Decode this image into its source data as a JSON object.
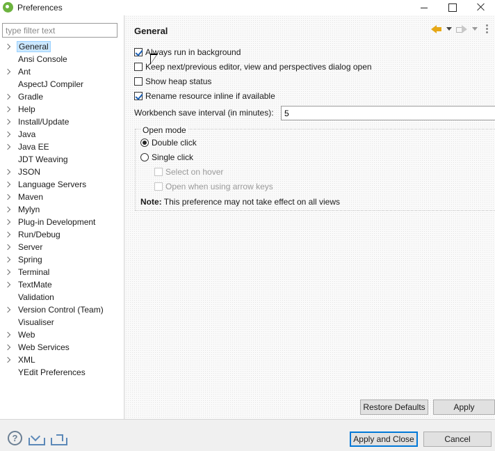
{
  "window": {
    "title": "Preferences"
  },
  "sidebar": {
    "filter_placeholder": "type filter text",
    "items": [
      {
        "label": "General",
        "expandable": true,
        "selected": true
      },
      {
        "label": "Ansi Console",
        "expandable": false
      },
      {
        "label": "Ant",
        "expandable": true
      },
      {
        "label": "AspectJ Compiler",
        "expandable": false
      },
      {
        "label": "Gradle",
        "expandable": true
      },
      {
        "label": "Help",
        "expandable": true
      },
      {
        "label": "Install/Update",
        "expandable": true
      },
      {
        "label": "Java",
        "expandable": true
      },
      {
        "label": "Java EE",
        "expandable": true
      },
      {
        "label": "JDT Weaving",
        "expandable": false
      },
      {
        "label": "JSON",
        "expandable": true
      },
      {
        "label": "Language Servers",
        "expandable": true
      },
      {
        "label": "Maven",
        "expandable": true
      },
      {
        "label": "Mylyn",
        "expandable": true
      },
      {
        "label": "Plug-in Development",
        "expandable": true
      },
      {
        "label": "Run/Debug",
        "expandable": true
      },
      {
        "label": "Server",
        "expandable": true
      },
      {
        "label": "Spring",
        "expandable": true
      },
      {
        "label": "Terminal",
        "expandable": true
      },
      {
        "label": "TextMate",
        "expandable": true
      },
      {
        "label": "Validation",
        "expandable": false
      },
      {
        "label": "Version Control (Team)",
        "expandable": true
      },
      {
        "label": "Visualiser",
        "expandable": false
      },
      {
        "label": "Web",
        "expandable": true
      },
      {
        "label": "Web Services",
        "expandable": true
      },
      {
        "label": "XML",
        "expandable": true
      },
      {
        "label": "YEdit Preferences",
        "expandable": false
      }
    ]
  },
  "main": {
    "title": "General",
    "options": {
      "always_run_background": {
        "label": "Always run in background",
        "checked": true
      },
      "keep_next_prev": {
        "label": "Keep next/previous editor, view and perspectives dialog open",
        "checked": false
      },
      "show_heap": {
        "label": "Show heap status",
        "checked": false
      },
      "rename_inline": {
        "label": "Rename resource inline if available",
        "checked": true
      }
    },
    "save_interval": {
      "label": "Workbench save interval (in minutes):",
      "value": "5"
    },
    "open_mode": {
      "title": "Open mode",
      "double_click": {
        "label": "Double click",
        "selected": true
      },
      "single_click": {
        "label": "Single click",
        "selected": false
      },
      "select_on_hover": {
        "label": "Select on hover",
        "enabled": false
      },
      "open_arrow_keys": {
        "label": "Open when using arrow keys",
        "enabled": false
      },
      "note_bold": "Note:",
      "note_text": " This preference may not take effect on all views"
    },
    "restore_defaults": "Restore Defaults",
    "apply": "Apply"
  },
  "footer": {
    "apply_close": "Apply and Close",
    "cancel": "Cancel",
    "help_glyph": "?"
  },
  "icons": [
    "app-icon",
    "back-icon",
    "forward-icon",
    "view-menu-icon",
    "help-icon",
    "import-icon",
    "export-icon"
  ],
  "colors": {
    "selection": "#cce8ff",
    "accent": "#0078d7",
    "nav_arrow": "#e6a817"
  }
}
